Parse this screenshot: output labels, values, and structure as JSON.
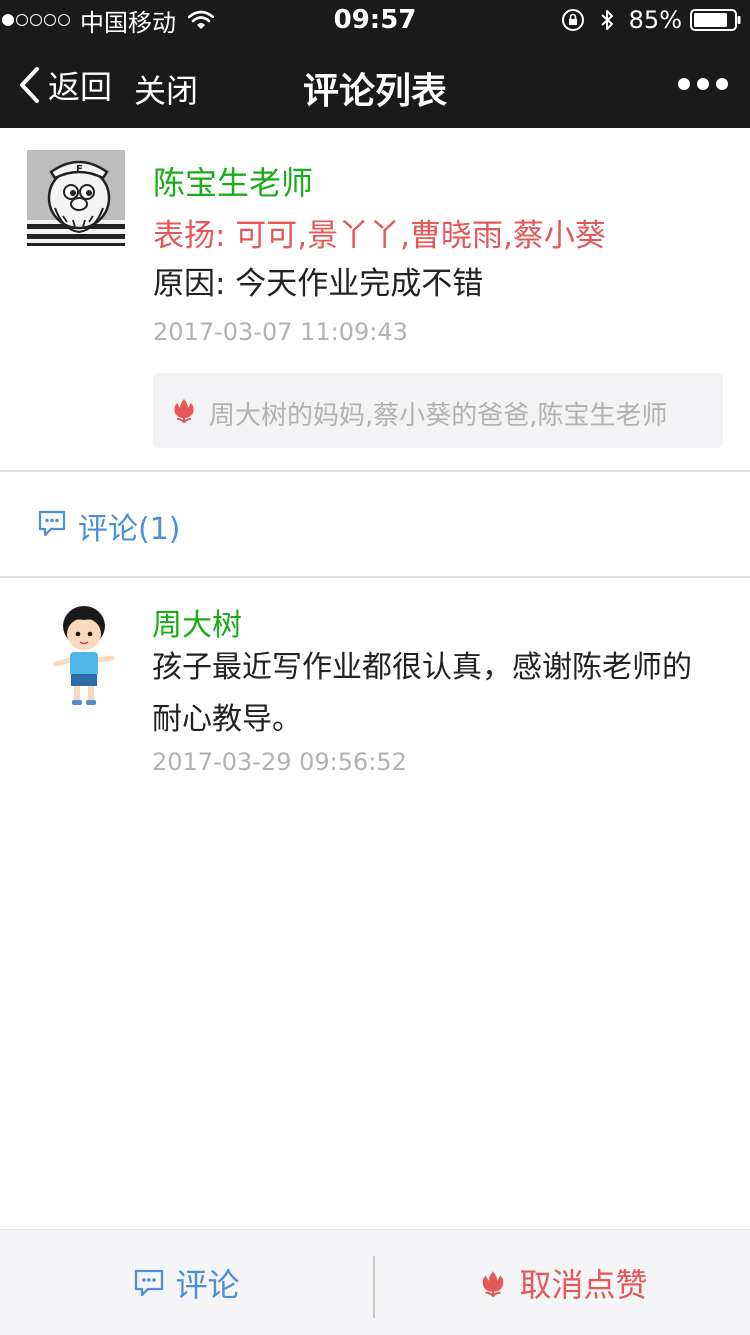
{
  "status_bar": {
    "carrier": "中国移动",
    "time": "09:57",
    "battery": "85%",
    "signal_strength": 1
  },
  "nav": {
    "back_label": "返回",
    "close_label": "关闭",
    "title": "评论列表"
  },
  "post": {
    "author": "陈宝生老师",
    "praise": "表扬: 可可,景丫丫,曹晓雨,蔡小葵",
    "reason": "原因: 今天作业完成不错",
    "time": "2017-03-07 11:09:43",
    "likes": "周大树的妈妈,蔡小葵的爸爸,陈宝生老师"
  },
  "comments_section": {
    "header": "评论(1)",
    "items": [
      {
        "name": "周大树",
        "text": "孩子最近写作业都很认真，感谢陈老师的耐心教导。",
        "time": "2017-03-29 09:56:52"
      }
    ]
  },
  "footer": {
    "comment_label": "评论",
    "like_label": "取消点赞"
  },
  "colors": {
    "name_green": "#1aad19",
    "praise_red": "#e65757",
    "link_blue": "#4d8fd6",
    "bar_dark": "#1a1a1a"
  }
}
